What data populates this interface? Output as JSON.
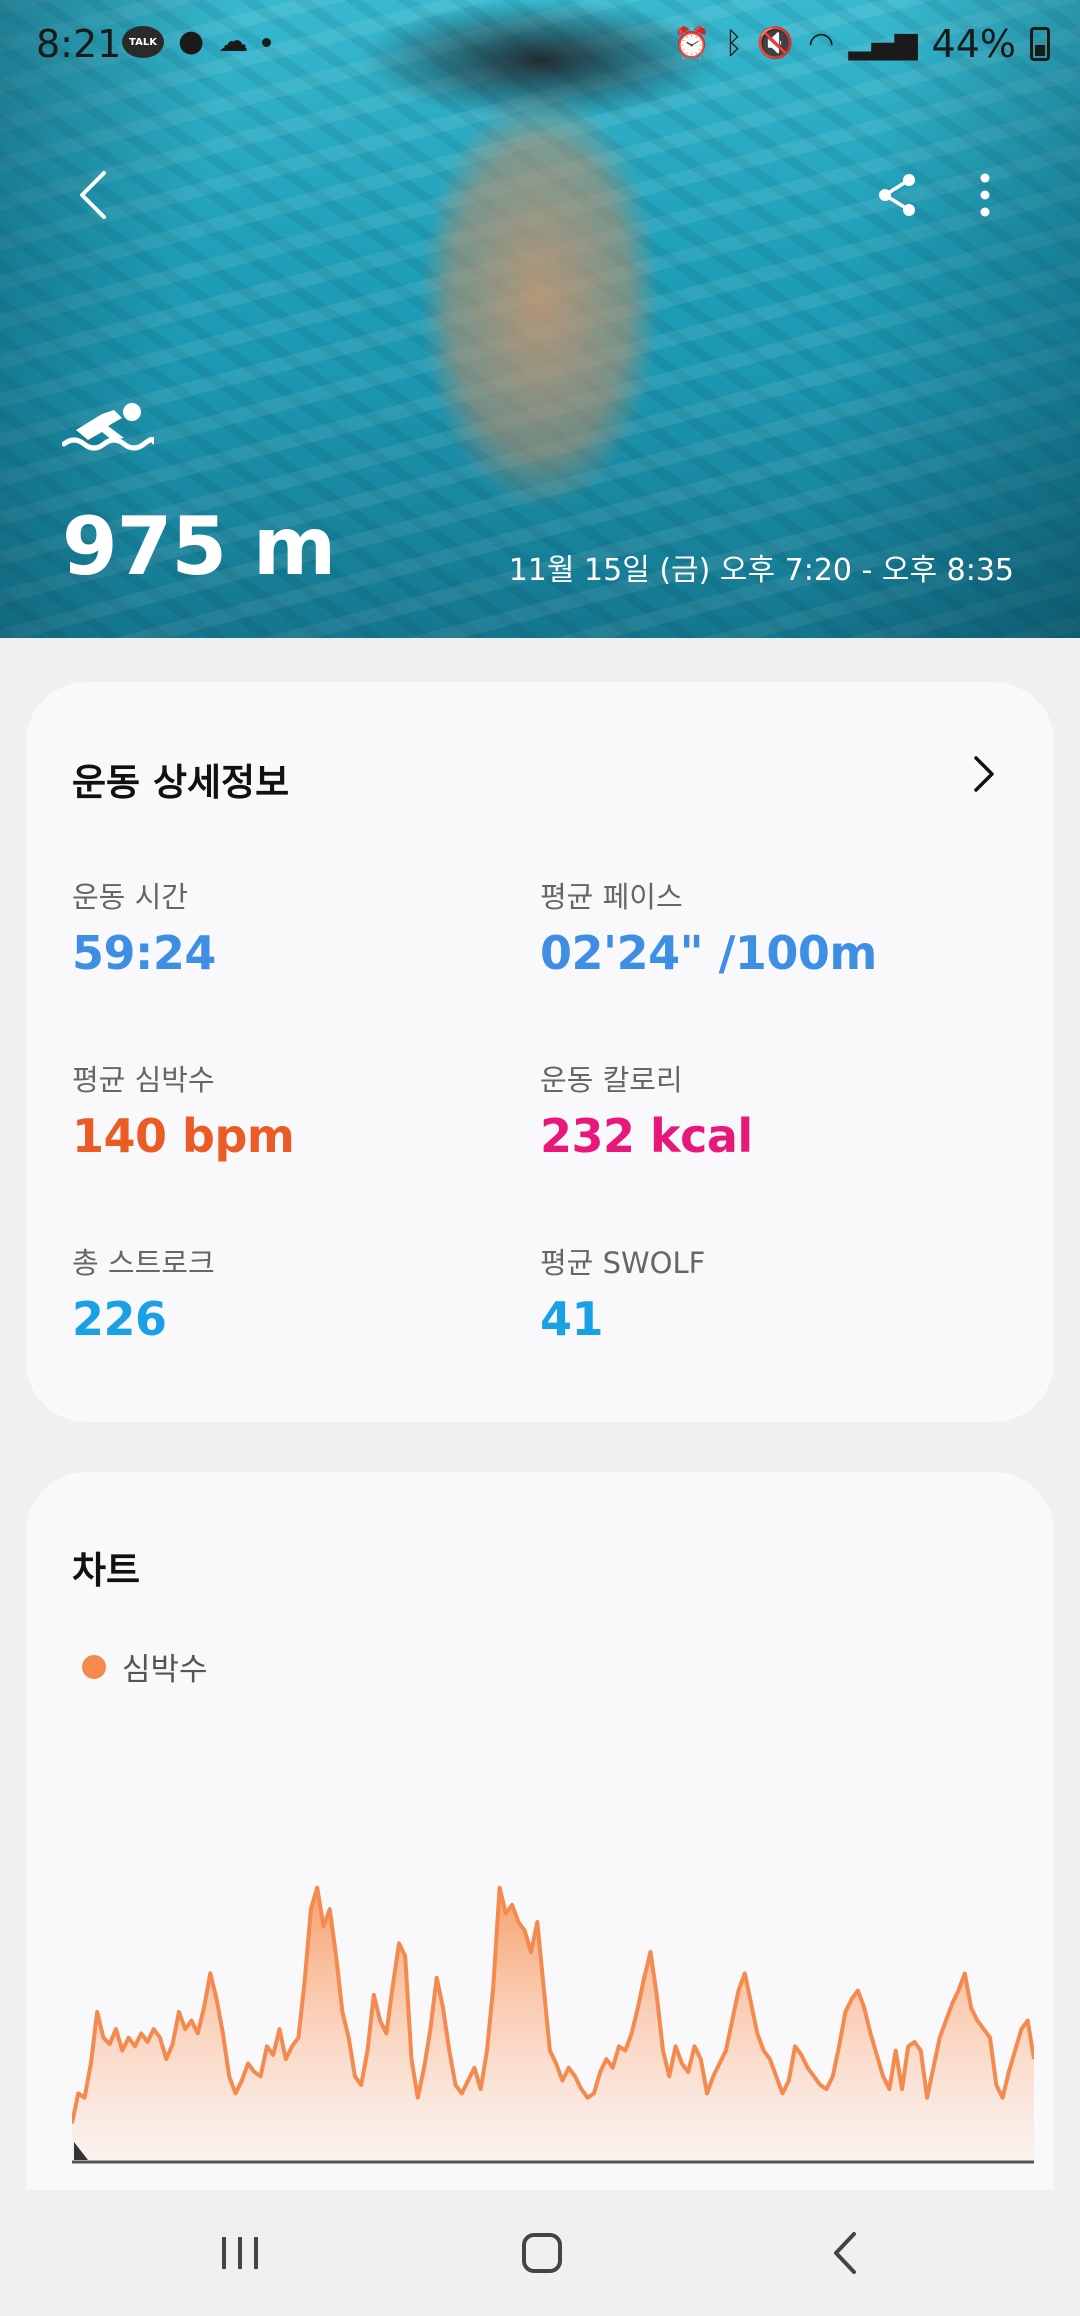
{
  "status": {
    "time": "8:21",
    "talk": "TALK",
    "battery": "44%"
  },
  "hero": {
    "distance": "975 m",
    "time_range": "11월 15일 (금) 오후 7:20 - 오후 8:35"
  },
  "details": {
    "title": "운동 상세정보",
    "stats": [
      {
        "label": "운동 시간",
        "value": "59:24",
        "color": "#3e8fe4"
      },
      {
        "label": "평균 페이스",
        "value": "02'24\" /100m",
        "color": "#3e8fe4"
      },
      {
        "label": "평균 심박수",
        "value": "140 bpm",
        "color": "#ea5b26"
      },
      {
        "label": "운동 칼로리",
        "value": "232 kcal",
        "color": "#e8177a"
      },
      {
        "label": "총 스트로크",
        "value": "226",
        "color": "#1aa0e4"
      },
      {
        "label": "평균 SWOLF",
        "value": "41",
        "color": "#1aa0e4"
      }
    ]
  },
  "chart": {
    "title": "차트",
    "legend": "심박수",
    "color": "#f48a4e"
  },
  "chart_data": {
    "type": "area",
    "series": [
      {
        "name": "심박수",
        "values": [
          18,
          32,
          30,
          46,
          70,
          58,
          55,
          62,
          52,
          58,
          54,
          60,
          56,
          62,
          58,
          48,
          55,
          70,
          62,
          66,
          60,
          72,
          88,
          76,
          60,
          40,
          32,
          38,
          46,
          42,
          40,
          54,
          50,
          62,
          48,
          54,
          58,
          84,
          118,
          128,
          110,
          118,
          96,
          70,
          58,
          40,
          36,
          52,
          78,
          66,
          60,
          82,
          102,
          96,
          48,
          30,
          44,
          62,
          86,
          72,
          52,
          36,
          32,
          38,
          44,
          34,
          52,
          82,
          128,
          116,
          120,
          112,
          108,
          98,
          112,
          82,
          52,
          46,
          38,
          44,
          40,
          34,
          30,
          32,
          42,
          48,
          44,
          54,
          52,
          60,
          72,
          86,
          98,
          78,
          52,
          40,
          54,
          46,
          42,
          54,
          48,
          32,
          40,
          46,
          52,
          66,
          80,
          88,
          74,
          60,
          52,
          48,
          40,
          32,
          38,
          54,
          50,
          44,
          40,
          36,
          34,
          40,
          54,
          70,
          76,
          80,
          72,
          60,
          50,
          40,
          34,
          52,
          34,
          54,
          56,
          52,
          30,
          44,
          58,
          66,
          74,
          80,
          88,
          72,
          66,
          62,
          58,
          36,
          30,
          42,
          52,
          62,
          66,
          48
        ]
      }
    ]
  }
}
